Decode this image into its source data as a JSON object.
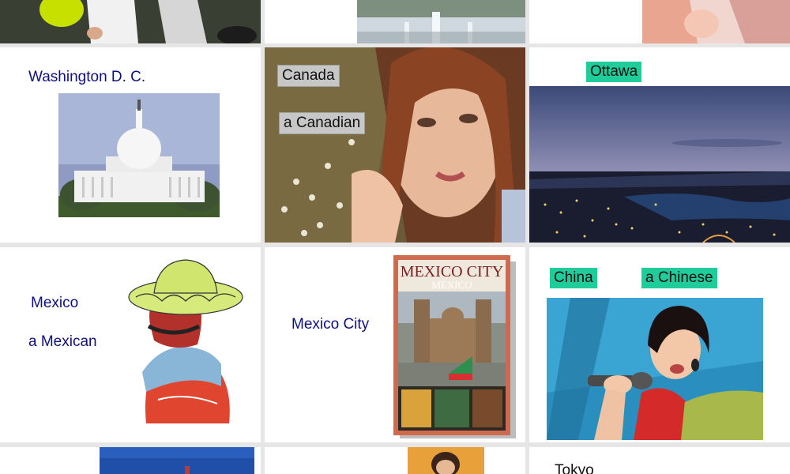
{
  "colors": {
    "tile_bg": "#ffffff",
    "gap_bg": "#e6e6e6",
    "label_text": "#0f1080",
    "gray_tag": "#c7c7c7",
    "teal_tag": "#1fcc9a"
  },
  "row2": {
    "usa": {
      "city": "Washington D. C."
    },
    "canada": {
      "country": "Canada",
      "nationality": "a Canadian"
    },
    "ottawa": {
      "city": "Ottawa"
    }
  },
  "row3": {
    "mexico": {
      "country": "Mexico",
      "nationality": "a Mexican"
    },
    "mexico_city": {
      "city": "Mexico City",
      "book_title": "MEXICO CITY",
      "book_subtitle": "MEXICO"
    },
    "china": {
      "country": "China",
      "nationality": "a Chinese"
    }
  },
  "row4": {
    "tokyo": {
      "city": "Tokyo"
    }
  },
  "images": {
    "soccer": "soccer player photo",
    "paris": "fountain city photo",
    "singer_top": "woman portrait photo",
    "capitol": "capitol building photo",
    "celine": "woman portrait photo",
    "ottawa_night": "city at night photo",
    "sombrero": "sombrero figure",
    "china_singer": "singer photo"
  }
}
